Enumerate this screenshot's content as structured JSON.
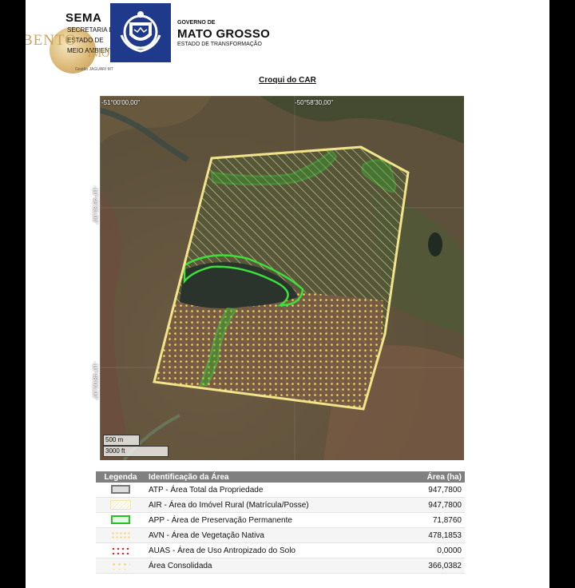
{
  "header": {
    "sema_title": "SEMA",
    "sema_lines": [
      "SECRETARIA DE",
      "ESTADO DE",
      "MEIO AMBIENTE"
    ],
    "sema_small": "Gestão JAGUARI MT",
    "watermark_1": "BENTO",
    "watermark_2": "IMÓVEIS",
    "gov_line_1": "GOVERNO DE",
    "gov_line_2": "MATO GROSSO",
    "gov_line_3": "ESTADO DE TRANSFORMAÇÃO"
  },
  "map": {
    "title": "Croqui do CAR",
    "coord_top_left": "-51°00'00,00\"",
    "coord_top_right": "-50°58'30,00\"",
    "coord_left_upper": "-10°46'30,00\"",
    "coord_left_lower": "-10°48'00,00\"",
    "scale_metric": "500 m",
    "scale_imperial": "3000 ft"
  },
  "legend": {
    "headers": {
      "legend": "Legenda",
      "id": "Identificação da Área",
      "area": "Área (ha)"
    },
    "rows": [
      {
        "swatch": "atp",
        "label": "ATP - Área Total da Propriedade",
        "area": "947,7800"
      },
      {
        "swatch": "air",
        "label": "AIR - Área do Imóvel Rural (Matrícula/Posse)",
        "area": "947,7800"
      },
      {
        "swatch": "app",
        "label": "APP - Área de Preservação Permanente",
        "area": "71,8760"
      },
      {
        "swatch": "avn",
        "label": "AVN - Área de Vegetação Nativa",
        "area": "478,1853"
      },
      {
        "swatch": "auas",
        "label": "AUAS - Área de Uso Antropizado do Solo",
        "area": "0,0000"
      },
      {
        "swatch": "cons",
        "label": "Área Consolidada",
        "area": "366,0382"
      }
    ]
  },
  "colors": {
    "gov_blue": "#1f3a8a",
    "app_green": "#22c322",
    "boundary_yellow": "#f1e48a",
    "consolidated_dots": "#f6d25f",
    "auas_dots": "#e0262a"
  }
}
